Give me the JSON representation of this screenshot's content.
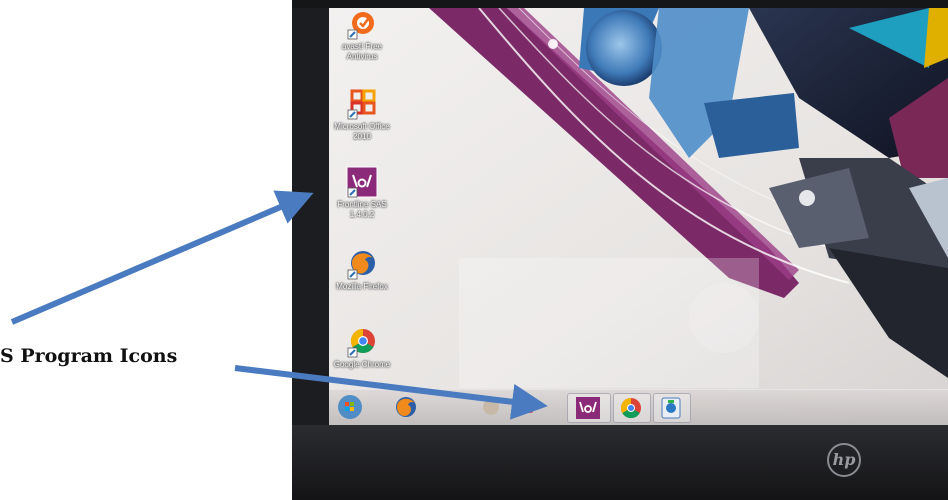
{
  "annotation": {
    "label": "S Program Icons",
    "arrow_color": "#4a7bc0"
  },
  "desktop_icons": [
    {
      "name": "avast-icon",
      "label": "avast! Free Antivirus"
    },
    {
      "name": "office-icon",
      "label": "Microsoft Office 2010"
    },
    {
      "name": "frontline-sas-icon",
      "label": "Frontline SAS 1.4.0.2"
    },
    {
      "name": "firefox-icon",
      "label": "Mozilla Firefox"
    },
    {
      "name": "chrome-icon",
      "label": "Google Chrome"
    }
  ],
  "taskbar": {
    "items": [
      "start-orb-icon",
      "firefox-icon",
      "pinned-app-icon",
      "pinned-app-icon",
      "frontline-sas-icon",
      "chrome-icon",
      "network-app-icon"
    ]
  },
  "device": {
    "brand_mark": "hp"
  },
  "colors": {
    "wallpaper_purple": "#7b2a67",
    "screen_bg": "#ebe8e6",
    "sas_icon_bg": "#8b2a78"
  }
}
